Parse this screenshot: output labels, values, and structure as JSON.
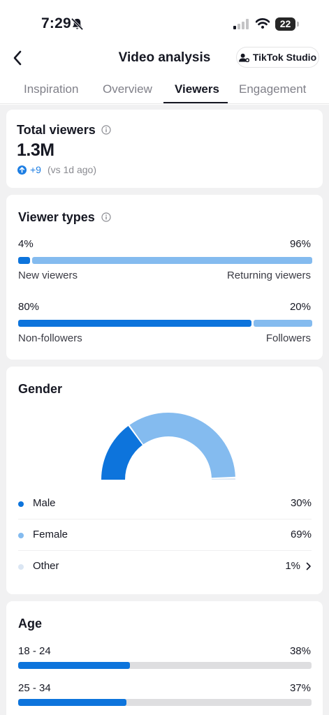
{
  "status_bar": {
    "time": "7:29",
    "battery": "22"
  },
  "header": {
    "title": "Video analysis",
    "studio_button": "TikTok Studio",
    "tabs": [
      {
        "label": "Inspiration",
        "active": false
      },
      {
        "label": "Overview",
        "active": false
      },
      {
        "label": "Viewers",
        "active": true
      },
      {
        "label": "Engagement",
        "active": false
      }
    ]
  },
  "total_viewers": {
    "title": "Total viewers",
    "value": "1.3M",
    "delta": "+9",
    "delta_note": "(vs 1d ago)"
  },
  "viewer_types": {
    "title": "Viewer types",
    "rows": [
      {
        "left_pct": "4%",
        "right_pct": "96%",
        "left_label": "New viewers",
        "right_label": "Returning viewers",
        "left_value": 4
      },
      {
        "left_pct": "80%",
        "right_pct": "20%",
        "left_label": "Non-followers",
        "right_label": "Followers",
        "left_value": 80
      }
    ]
  },
  "gender": {
    "title": "Gender",
    "items": [
      {
        "name": "Male",
        "value": "30%",
        "percent": 30,
        "color": "#0d74dc"
      },
      {
        "name": "Female",
        "value": "69%",
        "percent": 69,
        "color": "#84bbef"
      },
      {
        "name": "Other",
        "value": "1%",
        "percent": 1,
        "color": "#dbe6f3"
      }
    ]
  },
  "age": {
    "title": "Age",
    "items": [
      {
        "range": "18 - 24",
        "value": "38%",
        "percent": 38
      },
      {
        "range": "25 - 34",
        "value": "37%",
        "percent": 37
      }
    ]
  },
  "colors": {
    "accent": "#0d74dc",
    "accent_light": "#84bbef",
    "background": "#f1f1f2"
  }
}
